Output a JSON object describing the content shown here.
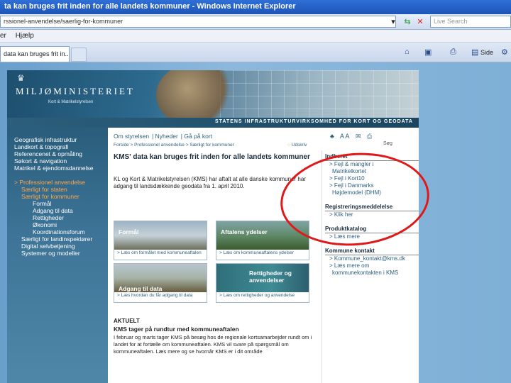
{
  "window": {
    "title": "ta kan bruges frit inden for alle landets kommuner - Windows Internet Explorer"
  },
  "address": {
    "url": "rssionel-anvendelse/saerlig-for-kommuner",
    "search_placeholder": "Live Search"
  },
  "menu": {
    "items": [
      "er",
      "Hjælp"
    ]
  },
  "tab": {
    "label": "data kan bruges frit in..."
  },
  "toolbar": {
    "page_label": "Side"
  },
  "site": {
    "logo": "MILJØMINISTERIET",
    "logo_sub": "Kort & Matrikelstyrelsen",
    "strapline": "STATENS INFRASTRUKTURVIRKSOMHED FOR KORT OG GEODATA"
  },
  "sidebar": {
    "items": [
      "Geografisk infrastruktur",
      "Landkort & topografi",
      "Referencenet & opmåling",
      "Søkort & navigation",
      "Matrikel & ejendomsdannelse"
    ],
    "active": "Professionel anvendelse",
    "sub": [
      "Særligt for staten",
      "Særligt for kommuner"
    ],
    "sub2": [
      "Formål",
      "Adgang til data",
      "Rettigheder",
      "Økonomi",
      "Koordinationsforum"
    ],
    "after": [
      "Særligt for landinspektører",
      "Digital selvbetjening",
      "Systemer og modeller"
    ]
  },
  "topnav": {
    "items": [
      "Om styrelsen",
      "Nyheder",
      "Gå på kort"
    ]
  },
  "topicons": {
    "text_size": "A A"
  },
  "breadcrumb": "Forside > Professionel anvendelse > Særligt for kommuner",
  "udskriv": "Udskriv",
  "sog": "Søg",
  "main": {
    "headline": "KMS' data kan bruges frit inden for alle landets kommuner",
    "lead": "KL og Kort & Matrikelstyrelsen (KMS) har aftalt at alle danske kommuner har adgang til landsdækkende geodata fra 1. april 2010.",
    "tiles": [
      {
        "title": "Formål",
        "link": "> Læs om formålet med kommuneaftalen"
      },
      {
        "title": "Aftalens ydelser",
        "link": "> Læs om kommuneaftalens ydelser"
      },
      {
        "title": "Adgang til data",
        "link": "> Læs hvordan du får adgang til data"
      },
      {
        "title": "Rettigheder og anvendelser",
        "link": "> Læs om rettigheder og anvendelse"
      }
    ],
    "aktuelt_title": "AKTUELT",
    "aktuelt_head": "KMS tager på rundtur med kommuneaftalen",
    "aktuelt_body": "I februar og marts tager KMS på besøg hos de regionale kortsamarbejder rundt om i landet for at fortælle om kommuneaftalen. KMS vil svare på spørgsmål om kommuneaftalen. Læs mere og se hvornår KMS er i dit område"
  },
  "right": {
    "sections": [
      {
        "heading": "Indberet",
        "links": [
          "> Fejl & mangler i",
          "Matrikelkortet",
          "> Fejl i Kort10",
          "> Fejl i Danmarks",
          "Højdemodel (DHM)"
        ]
      },
      {
        "heading": "Registreringsmeddelelse",
        "links": [
          "> Klik her"
        ]
      },
      {
        "heading": "Produktkatalog",
        "links": [
          "> Læs mere"
        ]
      },
      {
        "heading": "Kommune kontakt",
        "links": [
          "> Kommune_kontakt@kms.dk",
          "> Læs mere om",
          "kommunekontakten i KMS"
        ]
      }
    ]
  }
}
